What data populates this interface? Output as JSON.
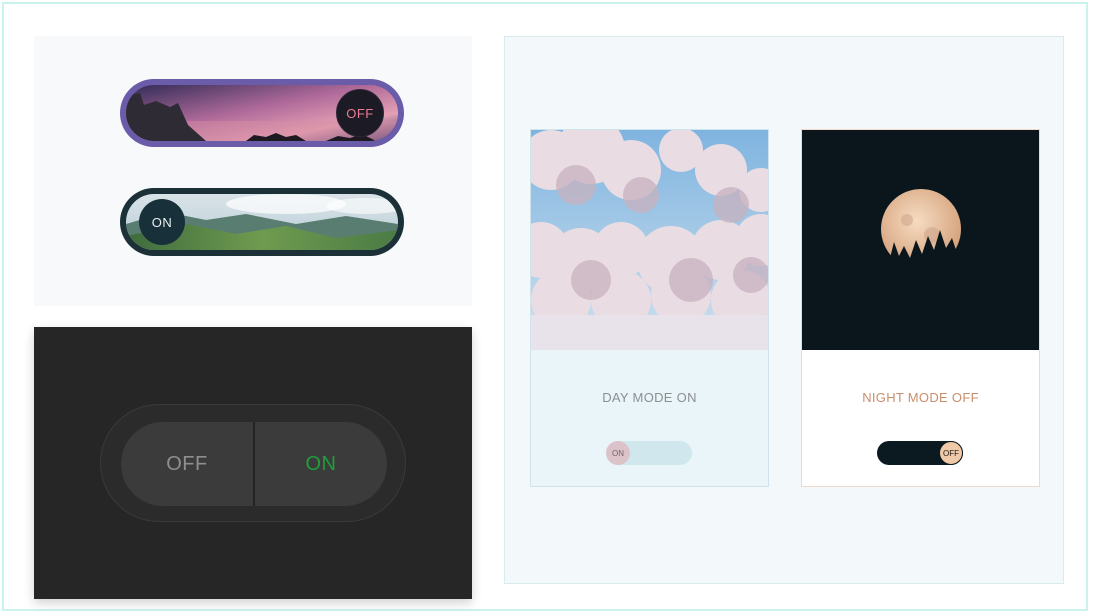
{
  "image_toggles": {
    "night": {
      "label": "OFF",
      "state": "off"
    },
    "day": {
      "label": "ON",
      "state": "on"
    }
  },
  "dark_segmented": {
    "off_label": "OFF",
    "on_label": "ON",
    "active": "ON"
  },
  "mode_cards": {
    "day": {
      "title": "DAY MODE ON",
      "knob_label": "ON",
      "state": "on"
    },
    "night": {
      "title": "NIGHT MODE OFF",
      "knob_label": "OFF",
      "state": "off"
    }
  },
  "colors": {
    "frame_border": "#c9f3ec",
    "night_pill": "#6a5ca8",
    "night_knob_text": "#e77d92",
    "day_pill": "#1c3038",
    "dark_panel": "#262626",
    "on_green": "#1f9e3a",
    "night_title": "#c98e6c",
    "moon": "#f0c9a8"
  }
}
